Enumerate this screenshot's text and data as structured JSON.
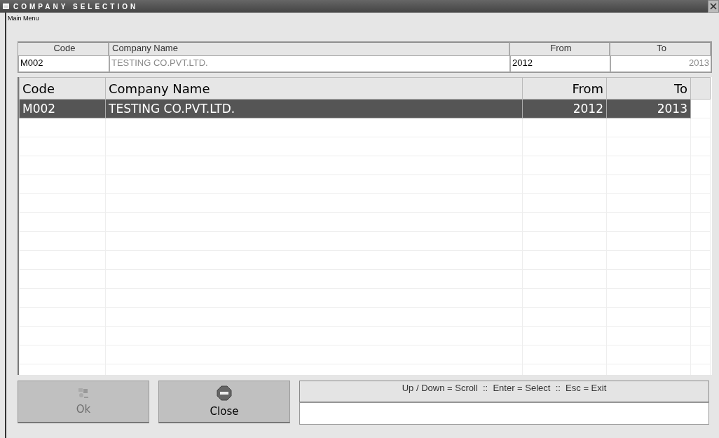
{
  "window": {
    "title": "COMPANY SELECTION"
  },
  "menu": {
    "label": "Main Menu"
  },
  "filter": {
    "columns": [
      {
        "label": "Code",
        "value": "M002",
        "disabled": false
      },
      {
        "label": "Company Name",
        "value": "TESTING CO.PVT.LTD.",
        "disabled": true
      },
      {
        "label": "From",
        "value": "2012",
        "disabled": false
      },
      {
        "label": "To",
        "value": "2013",
        "disabled": true
      }
    ]
  },
  "table": {
    "columns": [
      {
        "label": "Code"
      },
      {
        "label": "Company Name"
      },
      {
        "label": "From"
      },
      {
        "label": "To"
      }
    ],
    "rows": [
      {
        "cells": [
          "M002",
          "TESTING CO.PVT.LTD.",
          "2012",
          "2013"
        ],
        "selected": true
      }
    ]
  },
  "buttons": [
    {
      "label": "Ok",
      "kind": "ok",
      "disabled": true
    },
    {
      "label": "Close",
      "kind": "stop",
      "disabled": false
    }
  ],
  "status_bar": {
    "hint": "Up / Down = Scroll  ::  Enter = Select  ::  Esc = Exit"
  }
}
